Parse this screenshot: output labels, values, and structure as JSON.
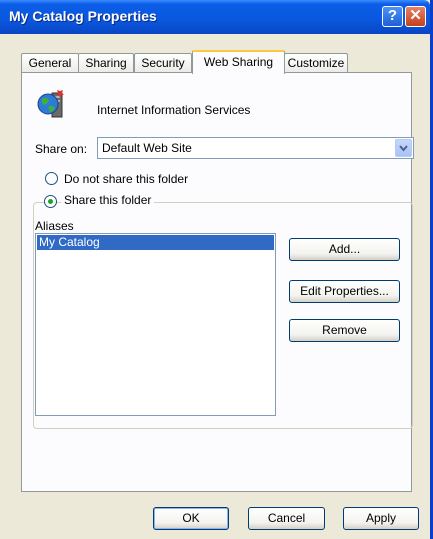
{
  "window": {
    "title": "My Catalog Properties",
    "help_label": "?",
    "close_label": "✕"
  },
  "tabs": [
    {
      "label": "General"
    },
    {
      "label": "Sharing"
    },
    {
      "label": "Security"
    },
    {
      "label": "Web Sharing"
    },
    {
      "label": "Customize"
    }
  ],
  "iis": {
    "label": "Internet Information Services",
    "icon": "globe-server-icon"
  },
  "share_on": {
    "label": "Share on:",
    "value": "Default Web Site"
  },
  "radios": {
    "no_share": {
      "label": "Do not share this folder",
      "checked": false
    },
    "share": {
      "label": "Share this folder",
      "checked": true
    }
  },
  "aliases": {
    "label": "Aliases",
    "items": [
      "My Catalog"
    ]
  },
  "side_buttons": {
    "add": "Add...",
    "edit": "Edit Properties...",
    "remove": "Remove"
  },
  "footer": {
    "ok": "OK",
    "cancel": "Cancel",
    "apply": "Apply"
  },
  "colors": {
    "titlebar": "#0A57DE",
    "selection": "#316AC5",
    "active_tab_accent": "#FFC83C"
  }
}
